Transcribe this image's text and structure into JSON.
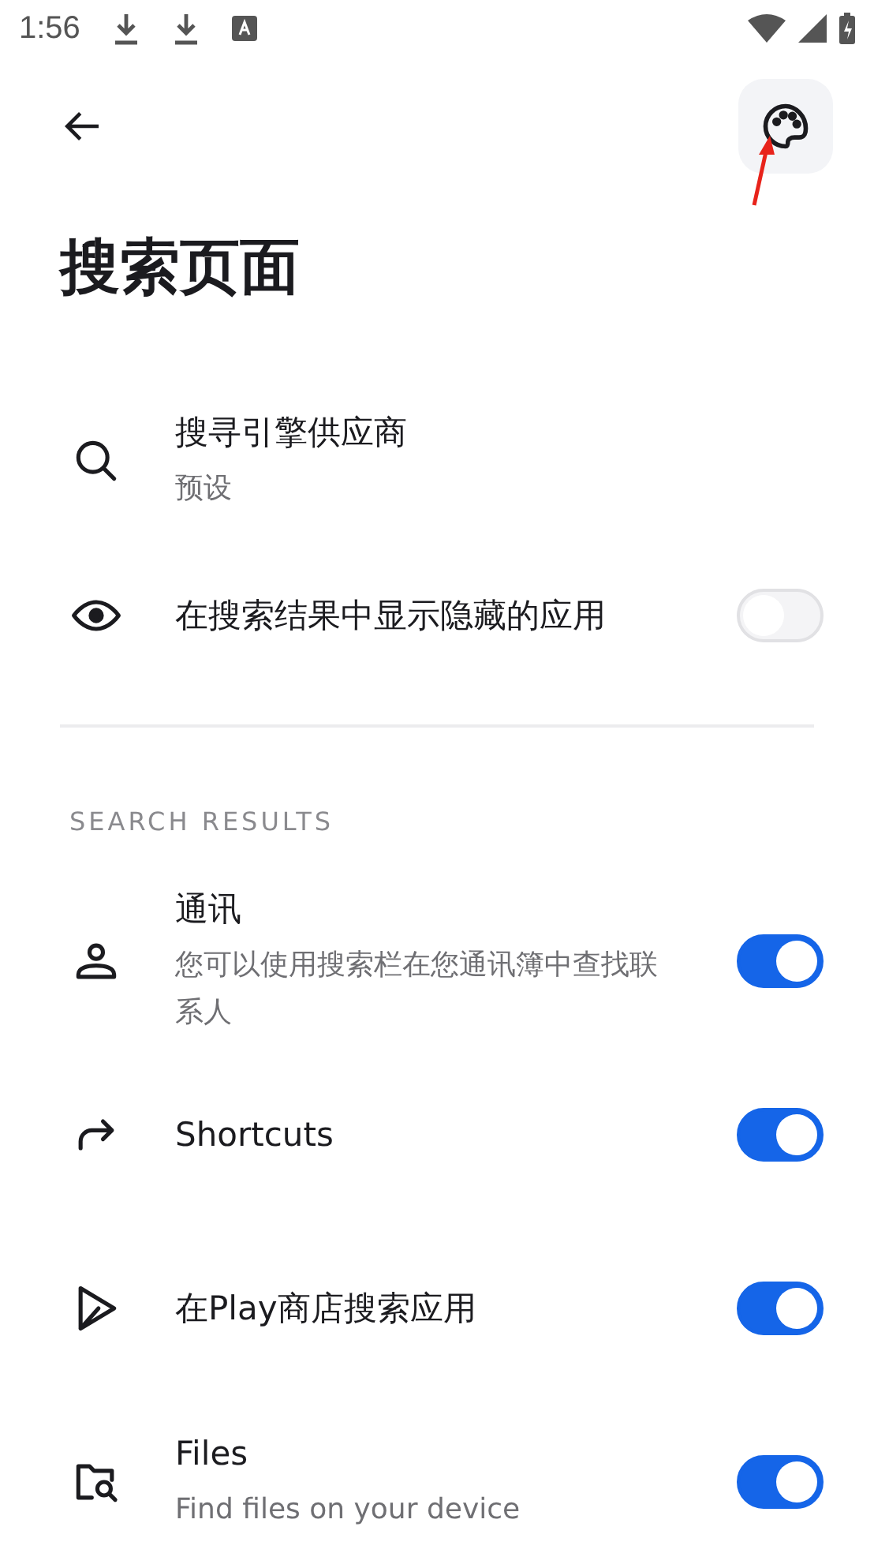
{
  "status_bar": {
    "time": "1:56"
  },
  "app_bar": {
    "title": "搜索页面"
  },
  "general_items": [
    {
      "kind": "item",
      "title": "搜寻引擎供应商",
      "subtitle": "预设"
    },
    {
      "kind": "switch",
      "title": "在搜索结果中显示隐藏的应用",
      "on": false
    }
  ],
  "section": {
    "header": "SEARCH RESULTS",
    "items": [
      {
        "kind": "switch",
        "title": "通讯",
        "subtitle": "您可以使用搜索栏在您通讯簿中查找联系人",
        "on": true
      },
      {
        "kind": "switch",
        "title": "Shortcuts",
        "on": true
      },
      {
        "kind": "switch",
        "title": "在Play商店搜索应用",
        "on": true
      },
      {
        "kind": "switch",
        "title": "Files",
        "subtitle": "Find files on your device",
        "on": true
      }
    ]
  }
}
